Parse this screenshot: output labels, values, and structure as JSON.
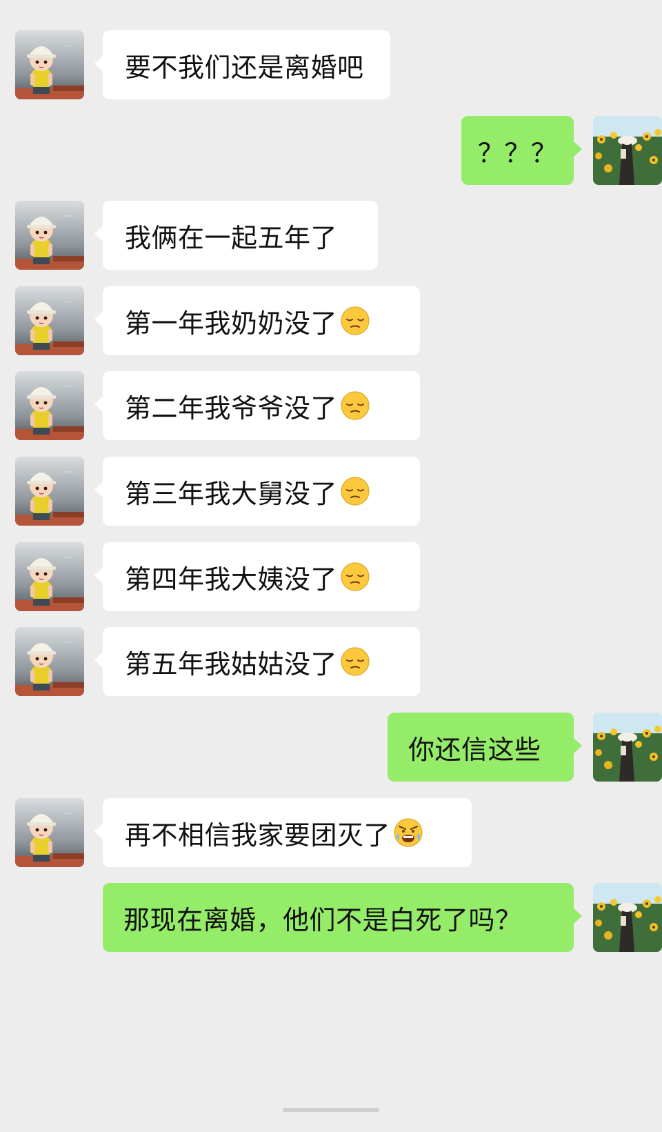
{
  "conversation": {
    "messages": [
      {
        "side": "left",
        "text": "要不我们还是离婚吧"
      },
      {
        "side": "right",
        "text": "？？？"
      },
      {
        "side": "left",
        "text": "我俩在一起五年了"
      },
      {
        "side": "left",
        "text": "第一年我奶奶没了",
        "emoji": "pensive-face-icon"
      },
      {
        "side": "left",
        "text": "第二年我爷爷没了",
        "emoji": "pensive-face-icon"
      },
      {
        "side": "left",
        "text": "第三年我大舅没了",
        "emoji": "pensive-face-icon"
      },
      {
        "side": "left",
        "text": "第四年我大姨没了",
        "emoji": "pensive-face-icon"
      },
      {
        "side": "left",
        "text": "第五年我姑姑没了",
        "emoji": "pensive-face-icon"
      },
      {
        "side": "right",
        "text": "你还信这些"
      },
      {
        "side": "left",
        "text": "再不相信我家要团灭了",
        "emoji": "angry-crying-face-icon"
      },
      {
        "side": "right",
        "text": "那现在离婚，他们不是白死了吗？"
      }
    ]
  },
  "avatars": {
    "contact": "construction-worker-boy-avatar",
    "self": "sunflower-field-girl-avatar"
  },
  "colors": {
    "background": "#ededed",
    "incoming_bubble": "#ffffff",
    "outgoing_bubble": "#95ec69",
    "text": "#111111"
  }
}
